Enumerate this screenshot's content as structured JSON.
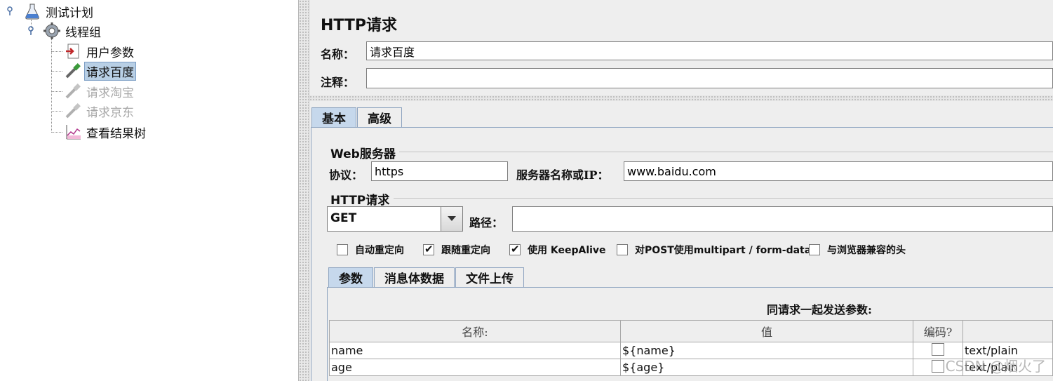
{
  "tree": {
    "root": {
      "label": "测试计划",
      "icon": "test-plan-icon"
    },
    "group": {
      "label": "线程组",
      "icon": "gear-icon"
    },
    "children": [
      {
        "label": "用户参数",
        "icon": "user-params-icon",
        "state": "normal"
      },
      {
        "label": "请求百度",
        "icon": "pipette-icon",
        "state": "selected"
      },
      {
        "label": "请求淘宝",
        "icon": "pipette-icon",
        "state": "disabled"
      },
      {
        "label": "请求京东",
        "icon": "pipette-icon",
        "state": "disabled"
      },
      {
        "label": "查看结果树",
        "icon": "chart-icon",
        "state": "normal"
      }
    ]
  },
  "sampler": {
    "title": "HTTP请求",
    "name_label": "名称：",
    "name_value": "请求百度",
    "comment_label": "注释：",
    "comment_value": ""
  },
  "tabs": {
    "main": [
      "基本",
      "高级"
    ],
    "active": "基本"
  },
  "web_server": {
    "group_title": "Web服务器",
    "protocol_label": "协议：",
    "protocol_value": "https",
    "server_label": "服务器名称或IP：",
    "server_value": "www.baidu.com"
  },
  "http_request": {
    "group_title": "HTTP请求",
    "method": "GET",
    "path_label": "路径：",
    "path_value": ""
  },
  "options": [
    {
      "label": "自动重定向",
      "checked": false
    },
    {
      "label": "跟随重定向",
      "checked": true
    },
    {
      "label": "使用 KeepAlive",
      "checked": true
    },
    {
      "label": "对POST使用multipart / form-data",
      "checked": false
    },
    {
      "label": "与浏览器兼容的头",
      "checked": false
    }
  ],
  "sub_tabs": {
    "items": [
      "参数",
      "消息体数据",
      "文件上传"
    ],
    "active": "参数"
  },
  "params_table": {
    "caption": "同请求一起发送参数:",
    "headers": [
      "名称:",
      "值",
      "编码?",
      ""
    ],
    "rows": [
      {
        "name": "name",
        "value": "${name}",
        "encode": false,
        "content_type": "text/plain"
      },
      {
        "name": "age",
        "value": "${age}",
        "encode": false,
        "content_type": "text/plain"
      }
    ]
  },
  "watermark": "CSDN @烟火了"
}
